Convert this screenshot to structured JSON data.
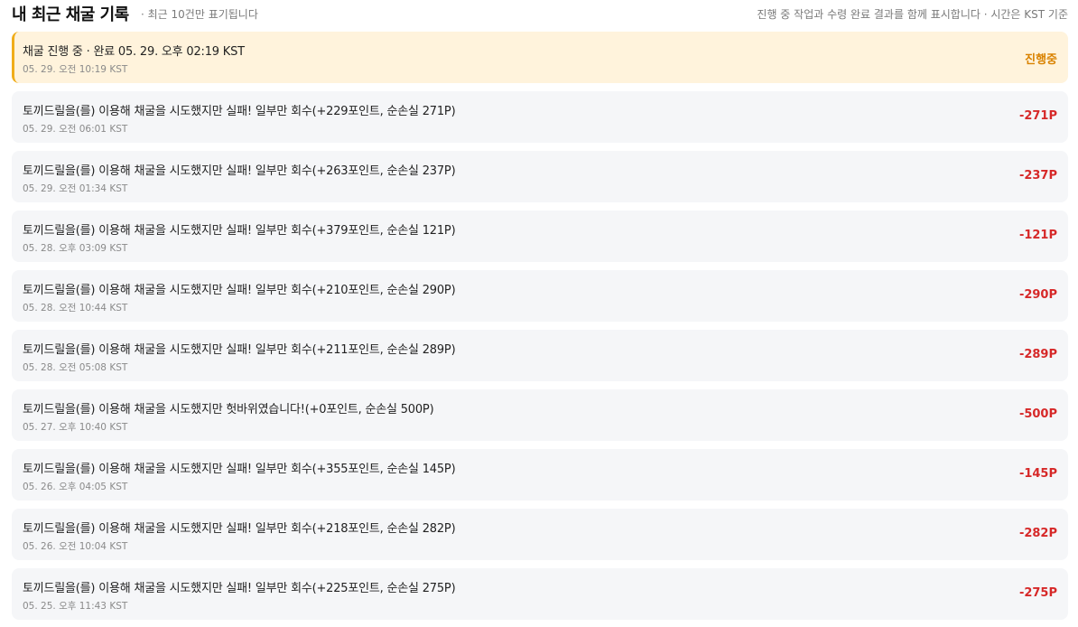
{
  "header": {
    "title": "내 최근 채굴 기록",
    "subtitle": "· 최근 10건만 표기됩니다",
    "note": "진행 중 작업과 수령 완료 결과를 함께 표시합니다 · 시간은 KST 기준"
  },
  "colors": {
    "active_bg": "#fff3dc",
    "active_border": "#f0ad1a",
    "active_text": "#d98200",
    "loss_text": "#d62828",
    "row_bg": "#f5f6f8"
  },
  "records": [
    {
      "message": "채굴 진행 중 · 완료 05. 29. 오후 02:19 KST",
      "time": "05. 29. 오전 10:19 KST",
      "amount": "진행중",
      "status": "active"
    },
    {
      "message": "토끼드릴을(를) 이용해 채굴을 시도했지만 실패! 일부만 회수(+229포인트, 순손실 271P)",
      "time": "05. 29. 오전 06:01 KST",
      "amount": "-271P",
      "status": "loss"
    },
    {
      "message": "토끼드릴을(를) 이용해 채굴을 시도했지만 실패! 일부만 회수(+263포인트, 순손실 237P)",
      "time": "05. 29. 오전 01:34 KST",
      "amount": "-237P",
      "status": "loss"
    },
    {
      "message": "토끼드릴을(를) 이용해 채굴을 시도했지만 실패! 일부만 회수(+379포인트, 순손실 121P)",
      "time": "05. 28. 오후 03:09 KST",
      "amount": "-121P",
      "status": "loss"
    },
    {
      "message": "토끼드릴을(를) 이용해 채굴을 시도했지만 실패! 일부만 회수(+210포인트, 순손실 290P)",
      "time": "05. 28. 오전 10:44 KST",
      "amount": "-290P",
      "status": "loss"
    },
    {
      "message": "토끼드릴을(를) 이용해 채굴을 시도했지만 실패! 일부만 회수(+211포인트, 순손실 289P)",
      "time": "05. 28. 오전 05:08 KST",
      "amount": "-289P",
      "status": "loss"
    },
    {
      "message": "토끼드릴을(를) 이용해 채굴을 시도했지만 헛바위였습니다!(+0포인트, 순손실 500P)",
      "time": "05. 27. 오후 10:40 KST",
      "amount": "-500P",
      "status": "loss"
    },
    {
      "message": "토끼드릴을(를) 이용해 채굴을 시도했지만 실패! 일부만 회수(+355포인트, 순손실 145P)",
      "time": "05. 26. 오후 04:05 KST",
      "amount": "-145P",
      "status": "loss"
    },
    {
      "message": "토끼드릴을(를) 이용해 채굴을 시도했지만 실패! 일부만 회수(+218포인트, 순손실 282P)",
      "time": "05. 26. 오전 10:04 KST",
      "amount": "-282P",
      "status": "loss"
    },
    {
      "message": "토끼드릴을(를) 이용해 채굴을 시도했지만 실패! 일부만 회수(+225포인트, 순손실 275P)",
      "time": "05. 25. 오후 11:43 KST",
      "amount": "-275P",
      "status": "loss"
    }
  ]
}
